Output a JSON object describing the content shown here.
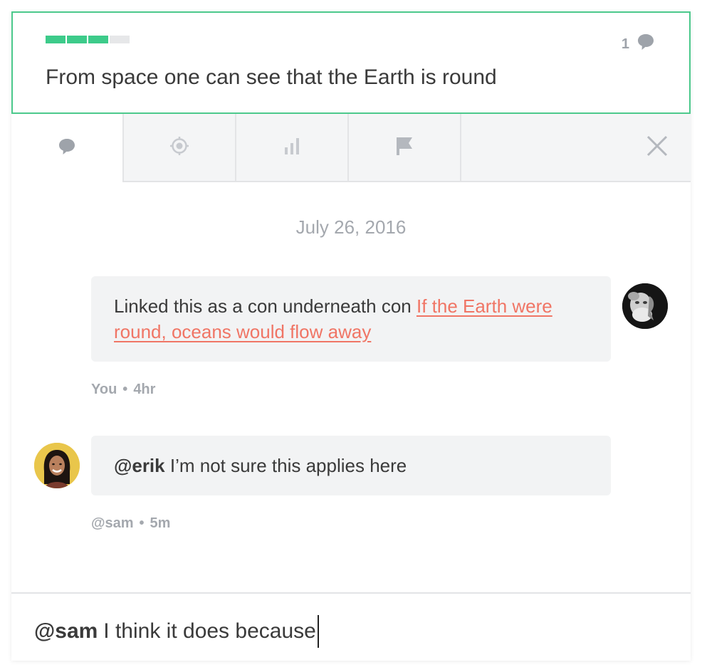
{
  "claim": {
    "strength_segments": [
      true,
      true,
      true,
      false
    ],
    "comment_count": "1",
    "text": "From space one can see that the Earth is round"
  },
  "tabs": [
    {
      "icon": "comment-icon",
      "active": true
    },
    {
      "icon": "target-icon",
      "active": false
    },
    {
      "icon": "bar-chart-icon",
      "active": false
    },
    {
      "icon": "flag-icon",
      "active": false
    }
  ],
  "thread": {
    "date": "July 26, 2016",
    "messages": [
      {
        "text_prefix": "Linked this as a con underneath con ",
        "link_text": "If the Earth were round, oceans would flow away",
        "author": "You",
        "time": "4hr"
      },
      {
        "mention": "@erik",
        "text": " I’m not sure this applies here",
        "author": "@sam",
        "time": "5m"
      }
    ]
  },
  "compose": {
    "mention": "@sam",
    "text": "I think it does because"
  },
  "colors": {
    "accent_green": "#3dcb8a",
    "link_red": "#f07565",
    "muted_gray": "#a4a8ae"
  }
}
